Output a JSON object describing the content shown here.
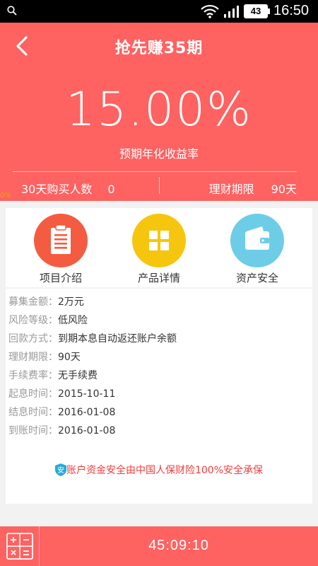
{
  "status_bar": {
    "battery": "43",
    "time": "16:50"
  },
  "header": {
    "title": "抢先赚35期",
    "rate": "15.00%",
    "rate_label": "预期年化收益率",
    "buyers_label": "30天购买人数",
    "buyers_value": "0",
    "term_label": "理财期限",
    "term_value": "90天",
    "accent_color": "#fe6261"
  },
  "progress": {
    "label": "0%",
    "value": 0
  },
  "features": [
    {
      "label": "项目介绍",
      "icon": "clipboard-icon",
      "color": "#f45c41"
    },
    {
      "label": "产品详情",
      "icon": "grid-icon",
      "color": "#f6c60f"
    },
    {
      "label": "资产安全",
      "icon": "wallet-icon",
      "color": "#6dcde6"
    }
  ],
  "details": [
    {
      "k": "募集金额：",
      "v": "2万元"
    },
    {
      "k": "风险等级：",
      "v": "低风险"
    },
    {
      "k": "回款方式：",
      "v": "到期本息自动返还账户余额"
    },
    {
      "k": "理财期限：",
      "v": "90天"
    },
    {
      "k": "手续费率：",
      "v": "无手续费"
    },
    {
      "k": "起息时间：",
      "v": "2015-10-11"
    },
    {
      "k": "结息时间：",
      "v": "2016-01-08"
    },
    {
      "k": "到账时间：",
      "v": "2016-01-08"
    }
  ],
  "guarantee": {
    "badge": "安",
    "text": "账户资金安全由中国人保财险100%安全承保"
  },
  "bottom": {
    "countdown": "45:09:10"
  }
}
